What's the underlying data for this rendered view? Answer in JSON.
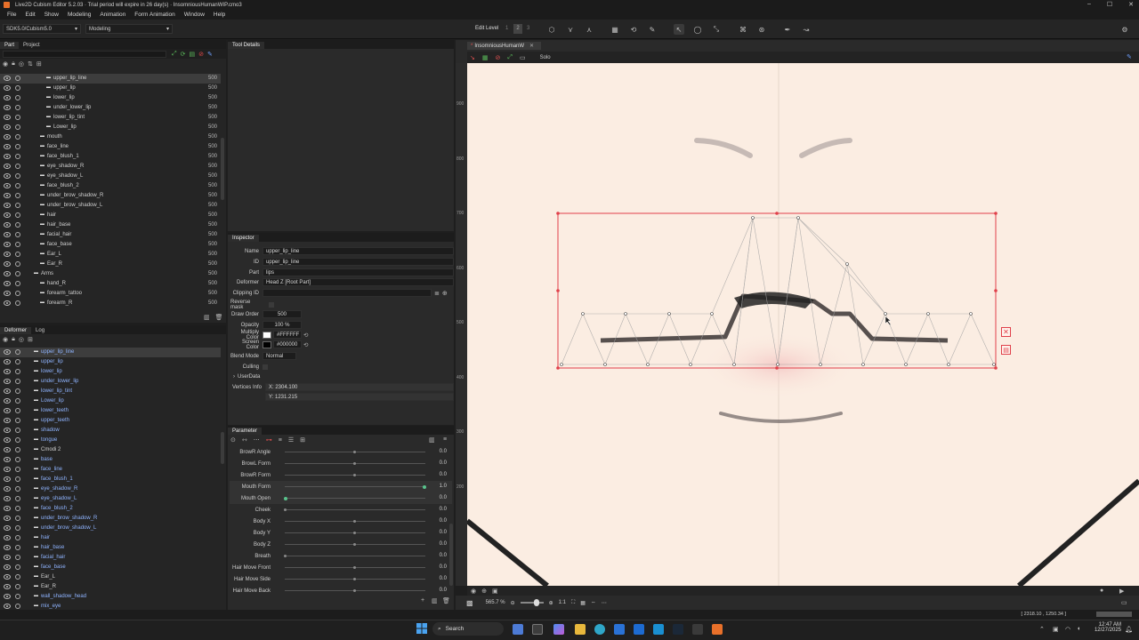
{
  "window": {
    "title": "Live2D Cubism Editor 5.2.03  ·  Trial period will expire in 26 day(s)  ·  InsomniousHumanWIP.cmo3",
    "controls": [
      "–",
      "☐",
      "✕"
    ]
  },
  "menu": [
    "File",
    "Edit",
    "Show",
    "Modeling",
    "Animation",
    "Form Animation",
    "Window",
    "Help"
  ],
  "toolbar": {
    "sdk_select": "SDK5.0/Cubism5.0",
    "mode_select": "Modeling",
    "edit_level_label": "Edit Level",
    "edit_levels": [
      "1",
      "2",
      "3"
    ]
  },
  "part_panel": {
    "tabs": [
      "Part",
      "Project"
    ],
    "rows": [
      {
        "label": "upper_lip_line",
        "value": "500",
        "selected": true,
        "indent": 60
      },
      {
        "label": "upper_lip",
        "value": "500",
        "indent": 60
      },
      {
        "label": "lower_lip",
        "value": "500",
        "indent": 60
      },
      {
        "label": "under_lower_lip",
        "value": "500",
        "indent": 60
      },
      {
        "label": "lower_lip_tint",
        "value": "500",
        "indent": 60
      },
      {
        "label": "Lower_lip",
        "value": "500",
        "indent": 60
      },
      {
        "label": "mouth",
        "value": "500",
        "indent": 53
      },
      {
        "label": "face_line",
        "value": "500",
        "indent": 53
      },
      {
        "label": "face_blush_1",
        "value": "500",
        "indent": 53
      },
      {
        "label": "eye_shadow_R",
        "value": "500",
        "indent": 53
      },
      {
        "label": "eye_shadow_L",
        "value": "500",
        "indent": 53
      },
      {
        "label": "face_blush_2",
        "value": "500",
        "indent": 53
      },
      {
        "label": "under_brow_shadow_R",
        "value": "500",
        "indent": 53
      },
      {
        "label": "under_brow_shadow_L",
        "value": "500",
        "indent": 53
      },
      {
        "label": "hair",
        "value": "500",
        "indent": 53
      },
      {
        "label": "hair_base",
        "value": "500",
        "indent": 53
      },
      {
        "label": "facial_hair",
        "value": "500",
        "indent": 53
      },
      {
        "label": "face_base",
        "value": "500",
        "indent": 53
      },
      {
        "label": "Ear_L",
        "value": "500",
        "indent": 53
      },
      {
        "label": "Ear_R",
        "value": "500",
        "indent": 53
      },
      {
        "label": "Arms",
        "value": "500",
        "indent": 46
      },
      {
        "label": "hand_R",
        "value": "500",
        "indent": 53
      },
      {
        "label": "forearm_tattoo",
        "value": "500",
        "indent": 53
      },
      {
        "label": "forearm_R",
        "value": "500",
        "indent": 53
      }
    ]
  },
  "tool_details": {
    "tab": "Tool Details"
  },
  "inspector": {
    "tab": "Inspector",
    "name_label": "Name",
    "name_value": "upper_lip_line",
    "id_label": "ID",
    "id_value": "upper_lip_line",
    "part_label": "Part",
    "part_value": "lips",
    "deformer_label": "Deformer",
    "deformer_value": "Head Z  [Root Part]",
    "clipping_label": "Clipping ID",
    "reverse_mask_label": "Reverse mask",
    "draw_order_label": "Draw Order",
    "draw_order_value": "500",
    "opacity_label": "Opacity",
    "opacity_value": "100 %",
    "multiply_label": "Multiply Color",
    "multiply_value": "#FFFFFF",
    "screen_label": "Screen Color",
    "screen_value": "#000000",
    "blend_label": "Blend Mode",
    "blend_value": "Normal",
    "culling_label": "Culling",
    "userdata_label": "UserData",
    "vertices_label": "Vertices Info",
    "vertices_x": "X: 2304.100",
    "vertices_y": "Y: 1231.215"
  },
  "deformer_panel": {
    "tabs": [
      "Deformer",
      "Log"
    ],
    "rows": [
      {
        "label": "upper_lip_line",
        "selected": true,
        "blue": true,
        "indent": 46
      },
      {
        "label": "upper_lip",
        "blue": true,
        "indent": 46
      },
      {
        "label": "lower_lip",
        "blue": true,
        "indent": 46
      },
      {
        "label": "under_lower_lip",
        "blue": true,
        "indent": 46
      },
      {
        "label": "lower_lip_tint",
        "blue": true,
        "indent": 46
      },
      {
        "label": "Lower_lip",
        "blue": true,
        "indent": 46
      },
      {
        "label": "lower_teeth",
        "blue": true,
        "indent": 46
      },
      {
        "label": "upper_teeth",
        "blue": true,
        "indent": 46
      },
      {
        "label": "shadow",
        "blue": true,
        "indent": 46
      },
      {
        "label": "tongue",
        "blue": true,
        "indent": 46
      },
      {
        "label": "Cmodi 2",
        "blue": false,
        "indent": 46
      },
      {
        "label": "base",
        "blue": true,
        "indent": 46
      },
      {
        "label": "face_line",
        "blue": true,
        "indent": 46
      },
      {
        "label": "face_blush_1",
        "blue": true,
        "indent": 46
      },
      {
        "label": "eye_shadow_R",
        "blue": true,
        "indent": 46
      },
      {
        "label": "eye_shadow_L",
        "blue": true,
        "indent": 46
      },
      {
        "label": "face_blush_2",
        "blue": true,
        "indent": 46
      },
      {
        "label": "under_brow_shadow_R",
        "blue": true,
        "indent": 46
      },
      {
        "label": "under_brow_shadow_L",
        "blue": true,
        "indent": 46
      },
      {
        "label": "hair",
        "blue": true,
        "indent": 46
      },
      {
        "label": "hair_base",
        "blue": true,
        "indent": 46
      },
      {
        "label": "facial_hair",
        "blue": true,
        "indent": 46
      },
      {
        "label": "face_base",
        "blue": true,
        "indent": 46
      },
      {
        "label": "Ear_L",
        "blue": false,
        "indent": 46
      },
      {
        "label": "Ear_R",
        "blue": false,
        "indent": 46
      },
      {
        "label": "wall_shadow_head",
        "blue": true,
        "indent": 46
      },
      {
        "label": "mix_eye",
        "blue": true,
        "indent": 46
      }
    ]
  },
  "parameter": {
    "tab": "Parameter",
    "rows": [
      {
        "name": "BrowR Angle",
        "value": "0.0",
        "pos": 0.5
      },
      {
        "name": "BrowL Form",
        "value": "0.0",
        "pos": 0.5
      },
      {
        "name": "BrowR Form",
        "value": "0.0",
        "pos": 0.5
      },
      {
        "name": "Mouth Form",
        "value": "1.0",
        "pos": 1.0,
        "active": true
      },
      {
        "name": "Mouth Open",
        "value": "0.0",
        "pos": 0.0,
        "active": true
      },
      {
        "name": "Cheek",
        "value": "0.0",
        "pos": 0.0
      },
      {
        "name": "Body X",
        "value": "0.0",
        "pos": 0.5
      },
      {
        "name": "Body Y",
        "value": "0.0",
        "pos": 0.5
      },
      {
        "name": "Body Z",
        "value": "0.0",
        "pos": 0.5
      },
      {
        "name": "Breath",
        "value": "0.0",
        "pos": 0.0
      },
      {
        "name": "Hair Move Front",
        "value": "0.0",
        "pos": 0.5
      },
      {
        "name": "Hair Move Side",
        "value": "0.0",
        "pos": 0.5
      },
      {
        "name": "Hair Move Back",
        "value": "0.0",
        "pos": 0.5
      }
    ]
  },
  "viewport": {
    "tab": "InsomniousHumanW",
    "solo_label": "Solo",
    "ruler": [
      "900",
      "800",
      "700",
      "600",
      "500",
      "400",
      "300",
      "200"
    ],
    "zoom": "565.7 %",
    "ratio": "1:1",
    "status_coords": "[ 2318.10 , 1250.34 ]",
    "selection_color": "#e0404a"
  },
  "taskbar": {
    "search_label": "Search",
    "time": "12:47 AM",
    "date": "12/27/2025"
  }
}
